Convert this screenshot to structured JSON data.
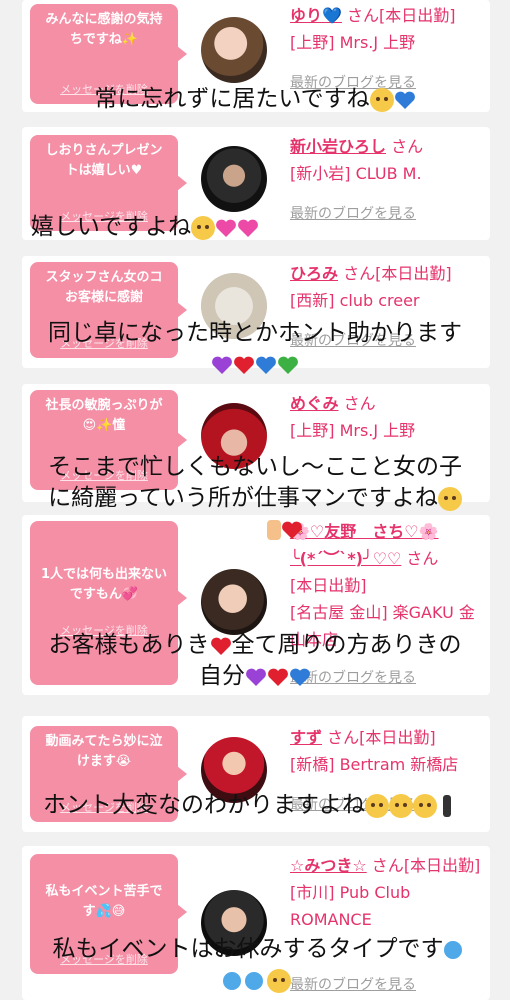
{
  "cards": [
    {
      "message": "みんなに感謝の気持ちですね✨",
      "delete": "メッセージを削除",
      "name": "ゆり💙",
      "san": "さん",
      "status": "[本日出勤]",
      "shop": "[上野] Mrs.J 上野",
      "blog": "最新のブログを見る"
    },
    {
      "message": "しおりさんプレゼントは嬉しい♥",
      "delete": "メッセージを削除",
      "name": "新小岩ひろし",
      "san": "さん",
      "status": "",
      "shop": "[新小岩] CLUB M.",
      "blog": "最新のブログを見る"
    },
    {
      "message": "スタッフさん女のコお客様に感謝",
      "delete": "メッセージを削除",
      "name": "ひろみ",
      "san": "さん",
      "status": "[本日出勤]",
      "shop": "[西新] club creer",
      "blog": "最新のブログを見る"
    },
    {
      "message": "社長の敏腕っぷりが😍✨憧",
      "delete": "メッセージを削除",
      "name": "めぐみ",
      "san": "さん",
      "status": "",
      "shop": "[上野] Mrs.J 上野",
      "blog": "最新のブログを見る"
    },
    {
      "message": "1人では何も出来ないですもん💞",
      "delete": "メッセージを削除",
      "name": "🌸♡友野　さち♡🌸",
      "name2": "╰(*´︶`*)╯♡♡",
      "san": "さん",
      "status": "[本日出勤]",
      "shop": "[名古屋 金山] 楽GAKU 金山本店",
      "blog": "最新のブログを見る"
    },
    {
      "message": "動画みてたら妙に泣けます😭",
      "delete": "メッセージを削除",
      "name": "すず",
      "san": "さん",
      "status": "[本日出勤]",
      "shop": "[新橋] Bertram 新橋店",
      "blog": "最新のブログを見る"
    },
    {
      "message": "私もイベント苦手です💦😅",
      "delete": "メッセージを削除",
      "name": "☆みつき☆",
      "san": "さん",
      "status": "[本日出勤]",
      "shop": "[市川] Pub Club ROMANCE",
      "blog": "最新のブログを見る"
    }
  ],
  "overlays": {
    "line1": "常に忘れずに居たいですね",
    "line2": "嬉しいですよね",
    "line3": "同じ卓になった時とかホント助かります",
    "line4a": "そこまで忙しくもないし〜ここと女の子",
    "line4b": "に綺麗っていう所が仕事マンですよね",
    "line5a": "お客様もありき",
    "line5b": "全て周りの方ありきの",
    "line5c": "自分",
    "line6": "ホント大変なのわかりますよね",
    "line7": "私もイベントはお休みするタイプです"
  },
  "colors": {
    "bubble": "#f48fa6",
    "name": "#e5336b",
    "link": "#9e9e9e",
    "background": "#f1f1f1"
  }
}
